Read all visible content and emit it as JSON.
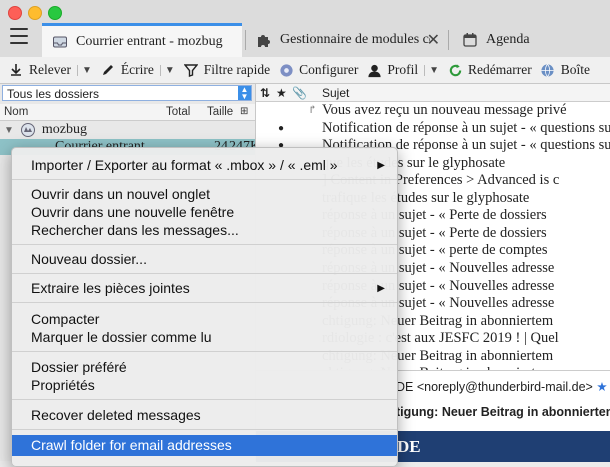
{
  "tabs": [
    {
      "label": "Courrier entrant - mozbug"
    },
    {
      "label": "Gestionnaire de modules complémentaires"
    },
    {
      "label": "Agenda"
    }
  ],
  "toolbar": {
    "get_messages": "Relever",
    "write": "Écrire",
    "quick_filter": "Filtre rapide",
    "configure": "Configurer",
    "profile": "Profil",
    "restart": "Redémarrer",
    "inbox": "Boîte"
  },
  "folderpane": {
    "folder_select": "Tous les dossiers",
    "col_name": "Nom",
    "col_total": "Total",
    "col_size": "Taille",
    "account": "mozbug",
    "selected_folder": "Courrier entrant",
    "selected_total": "24",
    "selected_size": "247Ko"
  },
  "messages": {
    "col_subject": "Sujet",
    "rows": [
      {
        "subject": "Vous avez reçu un nouveau message privé"
      },
      {
        "subject": "Notification de réponse à un sujet - « questions sur l'int"
      },
      {
        "subject": "Notification de réponse à un sujet - « questions sur l'int"
      },
      {
        "subject": "que les études sur le glyphosate"
      },
      {
        "subject": "] Content in Preferences > Advanced is c"
      },
      {
        "subject": "trafique les études sur le glyphosate"
      },
      {
        "subject": "réponse à un sujet - « Perte de dossiers"
      },
      {
        "subject": "réponse à un sujet - « Perte de dossiers"
      },
      {
        "subject": "réponse à un sujet - « perte de comptes"
      },
      {
        "subject": "réponse à un sujet - « Nouvelles adresse"
      },
      {
        "subject": "réponse à un sujet - « Nouvelles adresse"
      },
      {
        "subject": "réponse à un sujet - « Nouvelles adresse"
      },
      {
        "subject": "chtigung: Neuer Beitrag in abonniertem"
      },
      {
        "subject": "rdiologie : c'est aux JESFC 2019 ! | Quel"
      },
      {
        "subject": "chtigung: Neuer Beitrag in abonniertem"
      },
      {
        "subject": "chtigung: Neuer Beitrag in abonnierten"
      }
    ]
  },
  "preview": {
    "from": "DE <noreply@thunderbird-mail.de>",
    "subject": "tigung: Neuer Beitrag in abonniertem T",
    "band_text": "DE"
  },
  "context_menu": {
    "items": [
      {
        "label": "Importer / Exporter au format « .mbox » / « .eml »"
      },
      {
        "label": "Ouvrir dans un nouvel onglet"
      },
      {
        "label": "Ouvrir dans une nouvelle fenêtre"
      },
      {
        "label": "Rechercher dans les messages..."
      },
      {
        "label": "Nouveau dossier..."
      },
      {
        "label": "Extraire les pièces jointes"
      },
      {
        "label": "Compacter"
      },
      {
        "label": "Marquer le dossier comme lu"
      },
      {
        "label": "Dossier préféré"
      },
      {
        "label": "Propriétés"
      },
      {
        "label": "Recover deleted messages"
      },
      {
        "label": "Crawl folder for email addresses"
      }
    ]
  },
  "colors": {
    "accent": "#3b8fe8",
    "selected_folder": "#8ec2c7",
    "menu_highlight": "#2f73d9"
  }
}
